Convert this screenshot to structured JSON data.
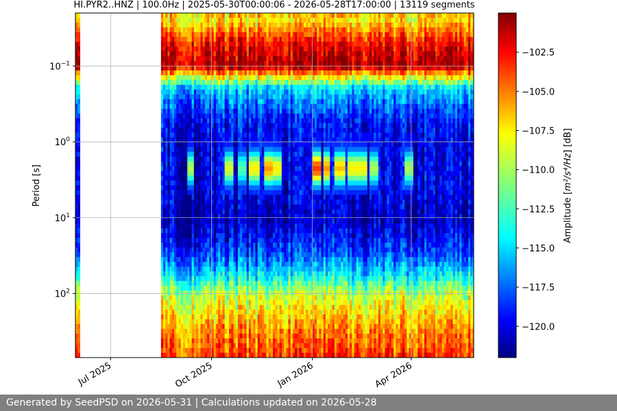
{
  "chart_data": {
    "type": "heatmap",
    "title": "HI.PYR2..HNZ | 100.0Hz | 2025-05-30T00:00:06 - 2026-05-28T17:00:00 | 13119 segments",
    "xlabel": "",
    "ylabel": "Period [s]",
    "x_scale": "time",
    "y_scale": "log",
    "y_inverted": true,
    "xlim": [
      "2025-05-30",
      "2026-05-28"
    ],
    "ylim": [
      0.02,
      700
    ],
    "x_ticks": [
      {
        "date": "2025-07-01",
        "label": "Jul 2025"
      },
      {
        "date": "2025-10-01",
        "label": "Oct 2025"
      },
      {
        "date": "2026-01-01",
        "label": "Jan 2026"
      },
      {
        "date": "2026-04-01",
        "label": "Apr 2026"
      }
    ],
    "y_ticks": [
      {
        "value": 0.1,
        "base": "10",
        "exp": "−1"
      },
      {
        "value": 1,
        "base": "10",
        "exp": "0"
      },
      {
        "value": 10,
        "base": "10",
        "exp": "1"
      },
      {
        "value": 100,
        "base": "10",
        "exp": "2"
      }
    ],
    "grid": true,
    "data_gaps": [
      {
        "start": "2025-06-03",
        "end": "2025-08-16"
      }
    ],
    "colormap": "jet",
    "colorbar": {
      "label_main": "Amplitude [",
      "label_math": "m²/s⁴/Hz",
      "label_end": "] [dB]",
      "range": [
        -122,
        -100
      ],
      "ticks": [
        "−102.5",
        "−105.0",
        "−107.5",
        "−110.0",
        "−112.5",
        "−115.0",
        "−117.5",
        "−120.0"
      ],
      "tick_values": [
        -102.5,
        -105.0,
        -107.5,
        -110.0,
        -112.5,
        -115.0,
        -117.5,
        -120.0
      ]
    },
    "period_profile": [
      {
        "period": 0.02,
        "db": -107
      },
      {
        "period": 0.025,
        "db": -108
      },
      {
        "period": 0.05,
        "db": -103
      },
      {
        "period": 0.1,
        "db": -101
      },
      {
        "period": 0.13,
        "db": -107
      },
      {
        "period": 0.2,
        "db": -115
      },
      {
        "period": 0.5,
        "db": -119
      },
      {
        "period": 1,
        "db": -120
      },
      {
        "period": 5,
        "db": -120
      },
      {
        "period": 10,
        "db": -121
      },
      {
        "period": 30,
        "db": -118
      },
      {
        "period": 60,
        "db": -114
      },
      {
        "period": 100,
        "db": -110
      },
      {
        "period": 300,
        "db": -106
      },
      {
        "period": 700,
        "db": -104
      }
    ],
    "microseism_episodes": [
      {
        "start": "2025-09-08",
        "end": "2025-09-14",
        "max_db": -110
      },
      {
        "start": "2025-10-12",
        "end": "2025-10-20",
        "max_db": -109
      },
      {
        "start": "2025-10-24",
        "end": "2025-10-31",
        "max_db": -112
      },
      {
        "start": "2025-11-04",
        "end": "2025-11-12",
        "max_db": -108
      },
      {
        "start": "2025-11-17",
        "end": "2025-11-24",
        "max_db": -106
      },
      {
        "start": "2025-11-26",
        "end": "2025-12-02",
        "max_db": -108
      },
      {
        "start": "2026-01-01",
        "end": "2026-01-08",
        "max_db": -104
      },
      {
        "start": "2026-01-10",
        "end": "2026-01-16",
        "max_db": -106
      },
      {
        "start": "2026-01-20",
        "end": "2026-01-30",
        "max_db": -107
      },
      {
        "start": "2026-02-01",
        "end": "2026-02-08",
        "max_db": -108
      },
      {
        "start": "2026-02-10",
        "end": "2026-02-18",
        "max_db": -108
      },
      {
        "start": "2026-02-22",
        "end": "2026-02-28",
        "max_db": -110
      },
      {
        "start": "2026-03-25",
        "end": "2026-04-02",
        "max_db": -110
      }
    ]
  },
  "footer": {
    "text": "Generated by SeedPSD on 2026-05-31 | Calculations updated on 2026-05-28"
  }
}
